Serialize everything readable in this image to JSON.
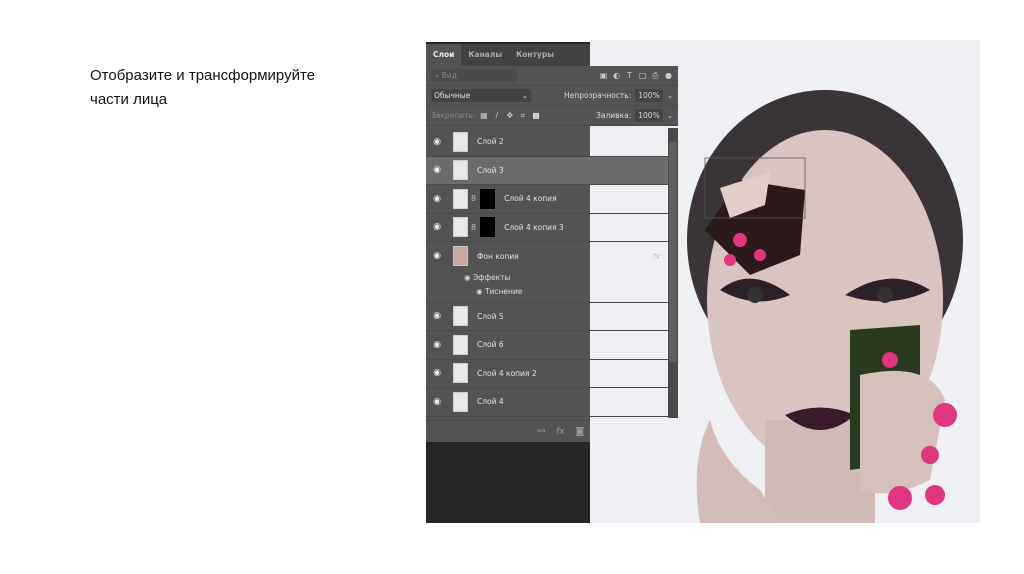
{
  "caption": {
    "line1": "Отобразите и трансформируйте",
    "line2": "части лица"
  },
  "panel": {
    "tabs": [
      "Слои",
      "Каналы",
      "Контуры"
    ],
    "collapse_icon": "«",
    "menu_icon": "≡",
    "search_placeholder": "Вид",
    "blend_mode": "Обычные",
    "opacity_label": "Непрозрачность:",
    "opacity_value": "100%",
    "lock_label": "Закрепить:",
    "fill_label": "Заливка:",
    "fill_value": "100%",
    "layers": [
      {
        "name": "Слой 2"
      },
      {
        "name": "Слой 3",
        "selected": true
      },
      {
        "name": "Слой 4 копия",
        "mask": true
      },
      {
        "name": "Слой 4 копия 3",
        "mask": true
      },
      {
        "name": "Фон копия",
        "fx": "fx"
      },
      {
        "name": "Слой 5"
      },
      {
        "name": "Слой 6"
      },
      {
        "name": "Слой 4 копия 2"
      },
      {
        "name": "Слой 4"
      }
    ],
    "effects_label": "Эффекты",
    "emboss_label": "Тиснение"
  },
  "colors": {
    "panel": "#535353",
    "selected": "#6b6b6b",
    "flower": "#e0357f"
  }
}
